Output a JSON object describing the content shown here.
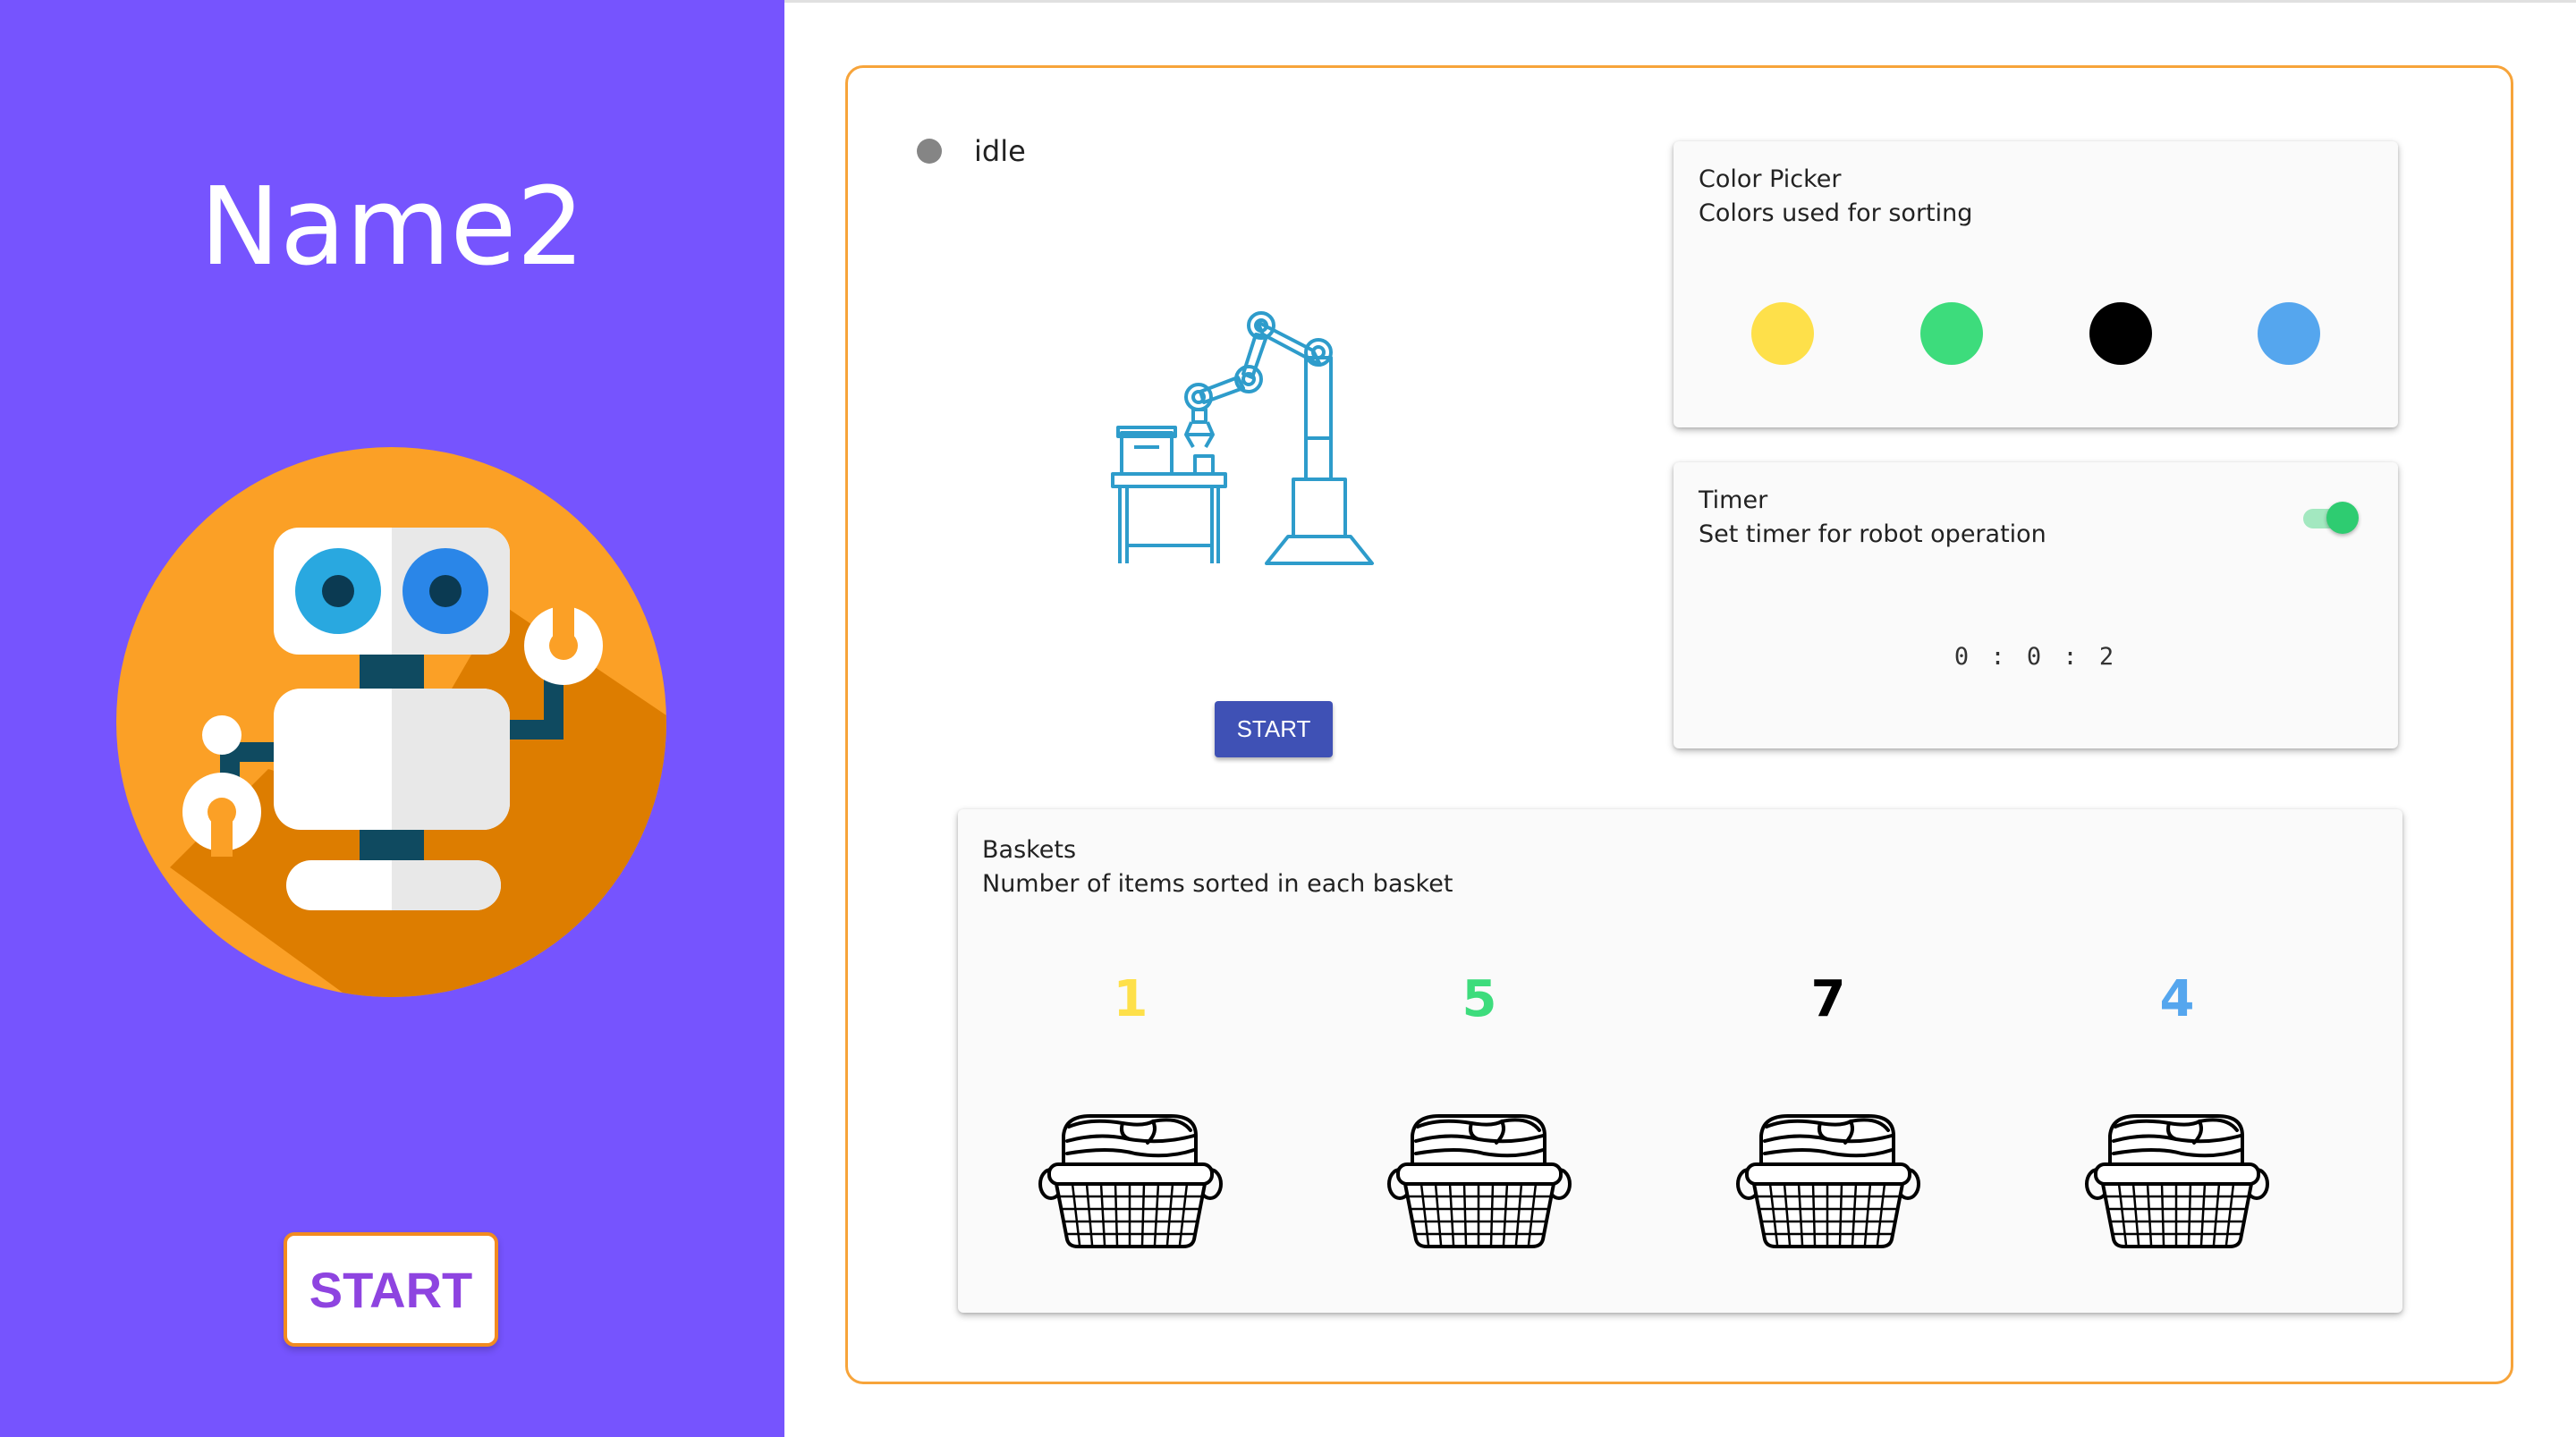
{
  "sidebar": {
    "title": "Name2",
    "start_label": "START",
    "background": "#7654fe"
  },
  "main": {
    "status": {
      "text": "idle",
      "dot_color": "#858585"
    },
    "start_label": "START",
    "border_color": "#f7a43a"
  },
  "color_picker": {
    "title": "Color Picker",
    "subtitle": "Colors used for sorting",
    "colors": [
      "#fee04a",
      "#3ddc7c",
      "#000000",
      "#55a6ee"
    ]
  },
  "timer": {
    "title": "Timer",
    "subtitle": "Set timer for robot operation",
    "enabled": true,
    "value": "0 : 0 : 2"
  },
  "baskets": {
    "title": "Baskets",
    "subtitle": "Number of items sorted in each basket",
    "items": [
      {
        "count": "1",
        "color": "#fee04a"
      },
      {
        "count": "5",
        "color": "#3ddc7c"
      },
      {
        "count": "7",
        "color": "#000000"
      },
      {
        "count": "4",
        "color": "#55a6ee"
      }
    ]
  }
}
